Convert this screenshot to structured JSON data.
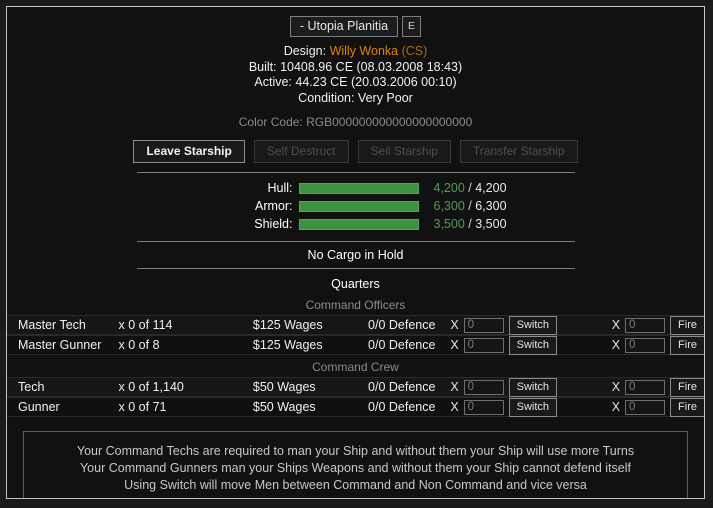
{
  "ship": {
    "name": "- Utopia Planitia",
    "edit_button": "E",
    "design_label": "Design:",
    "design_name": "Willy Wonka",
    "design_tag": "(CS)",
    "built": "Built: 10408.96 CE (08.03.2008 18:43)",
    "active": "Active: 44.23 CE (20.03.2006 00:10)",
    "condition": "Condition: Very Poor",
    "color_code": "Color Code: RGB000000000000000000000"
  },
  "actions": [
    {
      "label": "Leave Starship",
      "enabled": true
    },
    {
      "label": "Self Destruct",
      "enabled": false
    },
    {
      "label": "Sell Starship",
      "enabled": false
    },
    {
      "label": "Transfer Starship",
      "enabled": false
    }
  ],
  "stats": [
    {
      "label": "Hull:",
      "current": "4,200",
      "max": "4,200",
      "percent": 100,
      "color": "#3f9140"
    },
    {
      "label": "Armor:",
      "current": "6,300",
      "max": "6,300",
      "percent": 100,
      "color": "#3f9140"
    },
    {
      "label": "Shield:",
      "current": "3,500",
      "max": "3,500",
      "percent": 100,
      "color": "#3f9140"
    }
  ],
  "separator": "/",
  "cargo": "No Cargo in Hold",
  "quarters_title": "Quarters",
  "groups": [
    {
      "title": "Command Officers"
    },
    {
      "title": "Command Crew"
    }
  ],
  "crew": [
    {
      "name": "Master Tech",
      "count": "x 0 of 114",
      "wages": "$125 Wages",
      "defence": "0/0 Defence",
      "switch_x": "X",
      "switch_value": "0",
      "switch_label": "Switch",
      "fire_x": "X",
      "fire_value": "0",
      "fire_label": "Fire"
    },
    {
      "name": "Master Gunner",
      "count": "x 0 of 8",
      "wages": "$125 Wages",
      "defence": "0/0 Defence",
      "switch_x": "X",
      "switch_value": "0",
      "switch_label": "Switch",
      "fire_x": "X",
      "fire_value": "0",
      "fire_label": "Fire"
    },
    {
      "name": "Tech",
      "count": "x 0 of 1,140",
      "wages": "$50 Wages",
      "defence": "0/0 Defence",
      "switch_x": "X",
      "switch_value": "0",
      "switch_label": "Switch",
      "fire_x": "X",
      "fire_value": "0",
      "fire_label": "Fire"
    },
    {
      "name": "Gunner",
      "count": "x 0 of 71",
      "wages": "$50 Wages",
      "defence": "0/0 Defence",
      "switch_x": "X",
      "switch_value": "0",
      "switch_label": "Switch",
      "fire_x": "X",
      "fire_value": "0",
      "fire_label": "Fire"
    }
  ],
  "notes": [
    "Your Command Techs are required to man your Ship and without them your Ship will use more Turns",
    "Your Command Gunners man your Ships Weapons and without them your Ship cannot defend itself",
    "Using Switch will move Men between Command and Non Command and vice versa"
  ],
  "colors": {
    "accent_orange": "#e0800f",
    "bar_green": "#3f9140",
    "value_green": "#4f9e4f",
    "panel_border": "#c9c6c1",
    "muted": "#8b8b8b"
  }
}
